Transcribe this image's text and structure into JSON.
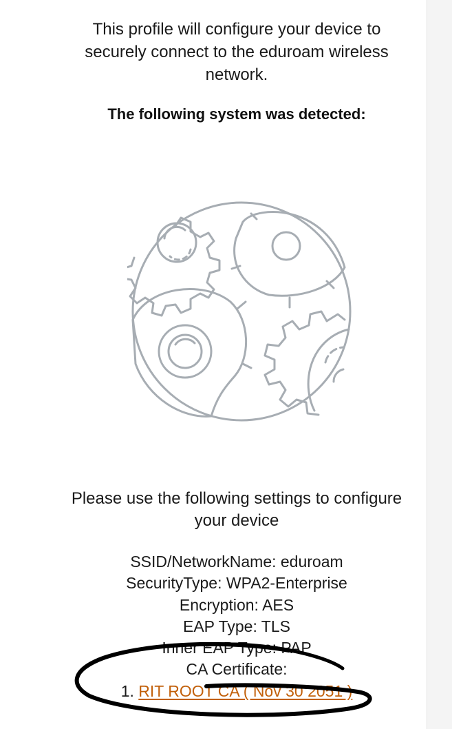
{
  "intro_text": "This profile will configure your device to securely connect to the eduroam wireless network.",
  "detected_heading": "The following system was detected:",
  "illustration_icon": "gears-globe-icon",
  "instructions_text": "Please use the following settings to configure your device",
  "settings": {
    "ssid": "SSID/NetworkName: eduroam",
    "security_type": "SecurityType: WPA2-Enterprise",
    "encryption": "Encryption: AES",
    "eap_type": "EAP Type: TLS",
    "inner_eap_type": "Inner EAP Type: PAP",
    "ca_certificate_label": "CA Certificate:",
    "certificate_number": "1.",
    "certificate_link": "RIT ROOT CA ( Nov 30 2051 )"
  },
  "colors": {
    "text": "#1a1a1a",
    "link": "#c2600a",
    "illustration": "#a7adb3",
    "annotation": "#000000"
  }
}
